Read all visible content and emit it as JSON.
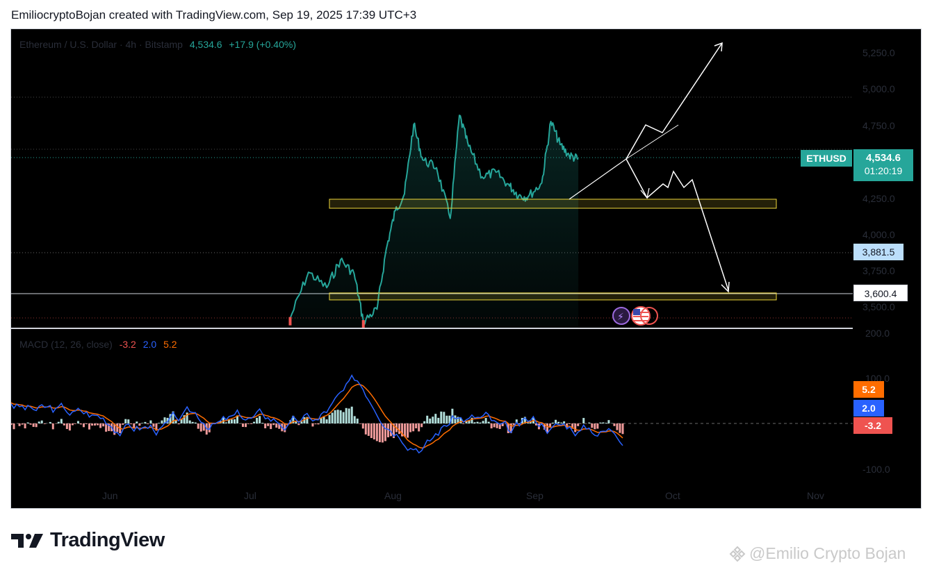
{
  "caption": "EmiliocryptoBojan created with TradingView.com, Sep 19, 2025 17:39 UTC+3",
  "symbol": {
    "description": "Ethereum / U.S. Dollar · 4h · Bitstamp",
    "price": "4,534.6",
    "change": "+17.9 (+0.40%)"
  },
  "ticker_tag": "ETHUSD",
  "last_price_tag": "4,534.6",
  "countdown": "01:20:19",
  "level_tags": [
    "3,881.5",
    "3,600.4"
  ],
  "price_axis": [
    "5,250.0",
    "5,000.0",
    "4,750.0",
    "4,250.0",
    "4,000.0",
    "3,750.0",
    "3,500.0"
  ],
  "macd_axis": [
    "200.0",
    "100.0",
    "-100.0"
  ],
  "macd": {
    "title": "MACD (12, 26, close)",
    "hist": "-3.2",
    "macd": "2.0",
    "signal": "5.2"
  },
  "time_axis": [
    "Jun",
    "Jul",
    "Aug",
    "Sep",
    "Oct",
    "Nov"
  ],
  "logo": "TradingView",
  "watermark": "@Emilio Crypto Bojan",
  "colors": {
    "up": "#26a69a",
    "down": "#ef5350",
    "macd_line": "#2962ff",
    "signal_line": "#ff6d00",
    "zone": "#f0d93a"
  },
  "chart_data": {
    "type": "line",
    "series": [
      {
        "name": "ETHUSD",
        "x": [
          "2025-07-18",
          "2025-07-22",
          "2025-07-26",
          "2025-07-29",
          "2025-08-01",
          "2025-08-03",
          "2025-08-06",
          "2025-08-08",
          "2025-08-10",
          "2025-08-12",
          "2025-08-14",
          "2025-08-16",
          "2025-08-19",
          "2025-08-22",
          "2025-08-24",
          "2025-08-26",
          "2025-08-29",
          "2025-09-01",
          "2025-09-04",
          "2025-09-06",
          "2025-09-08",
          "2025-09-11",
          "2025-09-13",
          "2025-09-15",
          "2025-09-17",
          "2025-09-19"
        ],
        "values": [
          3500,
          3800,
          3700,
          3880,
          3790,
          3480,
          3560,
          3950,
          4200,
          4310,
          4760,
          4530,
          4480,
          4150,
          4820,
          4620,
          4420,
          4450,
          4360,
          4300,
          4290,
          4380,
          4780,
          4630,
          4560,
          4534.6
        ]
      }
    ],
    "zones": [
      {
        "from": 4225,
        "to": 4255
      },
      {
        "from": 3585,
        "to": 3605
      }
    ],
    "horizontal_lines": [
      3881.5,
      3600.4
    ],
    "ylim": [
      3440,
      5380
    ],
    "xlim": [
      "2025-05-18",
      "2025-11-18"
    ],
    "grid": false
  }
}
